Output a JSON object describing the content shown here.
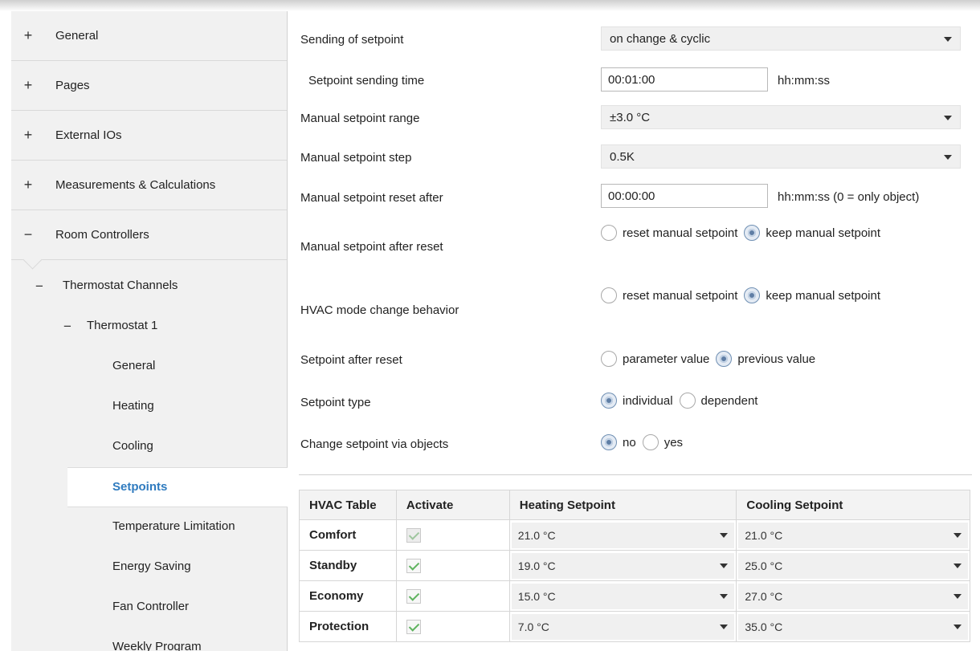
{
  "sidebar": {
    "top_items": [
      {
        "sign": "+",
        "label": "General"
      },
      {
        "sign": "+",
        "label": "Pages"
      },
      {
        "sign": "+",
        "label": "External IOs"
      },
      {
        "sign": "+",
        "label": "Measurements & Calculations"
      },
      {
        "sign": "−",
        "label": "Room Controllers"
      }
    ],
    "thermostat_channels": {
      "sign": "−",
      "label": "Thermostat Channels"
    },
    "thermostat_1": {
      "sign": "−",
      "label": "Thermostat 1"
    },
    "sub_items": [
      "General",
      "Heating",
      "Cooling",
      "Setpoints",
      "Temperature Limitation",
      "Energy Saving",
      "Fan Controller",
      "Weekly Program"
    ],
    "selected": "Setpoints"
  },
  "params": {
    "sending_of_setpoint": {
      "label": "Sending of setpoint",
      "value": "on change & cyclic"
    },
    "setpoint_sending_time": {
      "label": "Setpoint sending time",
      "value": "00:01:00",
      "unit": "hh:mm:ss"
    },
    "manual_setpoint_range": {
      "label": "Manual setpoint range",
      "value": "±3.0 °C"
    },
    "manual_setpoint_step": {
      "label": "Manual setpoint step",
      "value": "0.5K"
    },
    "manual_setpoint_reset_after": {
      "label": "Manual setpoint reset after",
      "value": "00:00:00",
      "unit": "hh:mm:ss (0 = only object)"
    },
    "manual_setpoint_after_reset": {
      "label": "Manual setpoint after reset",
      "options": [
        "reset manual setpoint",
        "keep manual setpoint"
      ],
      "selected": "keep manual setpoint"
    },
    "hvac_mode_change_behavior": {
      "label": "HVAC mode change behavior",
      "options": [
        "reset manual setpoint",
        "keep manual setpoint"
      ],
      "selected": "keep manual setpoint"
    },
    "setpoint_after_reset": {
      "label": "Setpoint after reset",
      "options": [
        "parameter value",
        "previous value"
      ],
      "selected": "previous value"
    },
    "setpoint_type": {
      "label": "Setpoint type",
      "options": [
        "individual",
        "dependent"
      ],
      "selected": "individual"
    },
    "change_setpoint_via_objects": {
      "label": "Change setpoint via objects",
      "options": [
        "no",
        "yes"
      ],
      "selected": "no"
    }
  },
  "hvac_table": {
    "headers": [
      "HVAC Table",
      "Activate",
      "Heating Setpoint",
      "Cooling Setpoint"
    ],
    "rows": [
      {
        "name": "Comfort",
        "activate": true,
        "activate_disabled": true,
        "heating": "21.0 °C",
        "cooling": "21.0 °C"
      },
      {
        "name": "Standby",
        "activate": true,
        "activate_disabled": false,
        "heating": "19.0 °C",
        "cooling": "25.0 °C"
      },
      {
        "name": "Economy",
        "activate": true,
        "activate_disabled": false,
        "heating": "15.0 °C",
        "cooling": "27.0 °C"
      },
      {
        "name": "Protection",
        "activate": true,
        "activate_disabled": false,
        "heating": "7.0 °C",
        "cooling": "35.0 °C"
      }
    ]
  },
  "colors": {
    "accent": "#2f7bbf",
    "checkmark": "#5fb35f",
    "sidebar_bg": "#f1f1f1"
  }
}
